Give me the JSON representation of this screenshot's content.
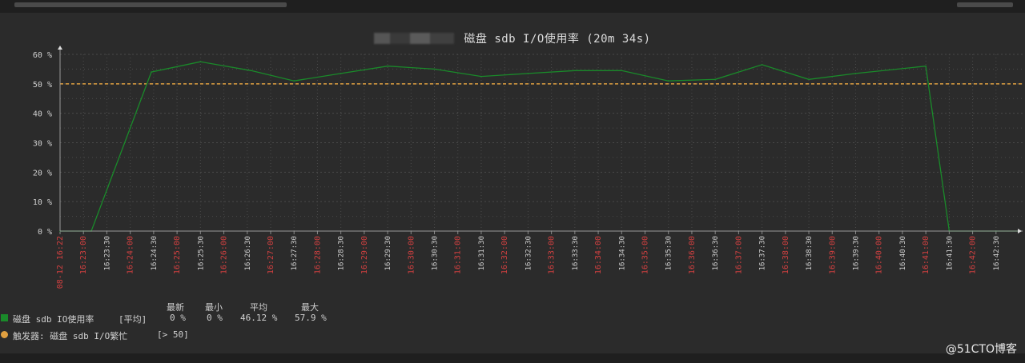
{
  "colors": {
    "background": "#2b2b2b",
    "grid": "#4a4a4a",
    "series": "#1a8a2a",
    "trigger": "#e0a040",
    "tick_red": "#d04040",
    "tick_white": "#d0d0d0"
  },
  "chart_data": {
    "type": "line",
    "title_suffix": "磁盘 sdb I/O使用率 (20m 34s)",
    "ylim": [
      0,
      60
    ],
    "y_ticks": [
      "60 %",
      "50 %",
      "40 %",
      "30 %",
      "20 %",
      "10 %",
      "0 %"
    ],
    "x_ticks": [
      {
        "label": "08-12 16:22",
        "red": true
      },
      {
        "label": "16:23:00",
        "red": true
      },
      {
        "label": "16:23:30",
        "red": false
      },
      {
        "label": "16:24:00",
        "red": true
      },
      {
        "label": "16:24:30",
        "red": false
      },
      {
        "label": "16:25:00",
        "red": true
      },
      {
        "label": "16:25:30",
        "red": false
      },
      {
        "label": "16:26:00",
        "red": true
      },
      {
        "label": "16:26:30",
        "red": false
      },
      {
        "label": "16:27:00",
        "red": true
      },
      {
        "label": "16:27:30",
        "red": false
      },
      {
        "label": "16:28:00",
        "red": true
      },
      {
        "label": "16:28:30",
        "red": false
      },
      {
        "label": "16:29:00",
        "red": true
      },
      {
        "label": "16:29:30",
        "red": false
      },
      {
        "label": "16:30:00",
        "red": true
      },
      {
        "label": "16:30:30",
        "red": false
      },
      {
        "label": "16:31:00",
        "red": true
      },
      {
        "label": "16:31:30",
        "red": false
      },
      {
        "label": "16:32:00",
        "red": true
      },
      {
        "label": "16:32:30",
        "red": false
      },
      {
        "label": "16:33:00",
        "red": true
      },
      {
        "label": "16:33:30",
        "red": false
      },
      {
        "label": "16:34:00",
        "red": true
      },
      {
        "label": "16:34:30",
        "red": false
      },
      {
        "label": "16:35:00",
        "red": true
      },
      {
        "label": "16:35:30",
        "red": false
      },
      {
        "label": "16:36:00",
        "red": true
      },
      {
        "label": "16:36:30",
        "red": false
      },
      {
        "label": "16:37:00",
        "red": true
      },
      {
        "label": "16:37:30",
        "red": false
      },
      {
        "label": "16:38:00",
        "red": true
      },
      {
        "label": "16:38:30",
        "red": false
      },
      {
        "label": "16:39:00",
        "red": true
      },
      {
        "label": "16:39:30",
        "red": false
      },
      {
        "label": "16:40:00",
        "red": true
      },
      {
        "label": "16:40:30",
        "red": false
      },
      {
        "label": "16:41:00",
        "red": true
      },
      {
        "label": "16:41:30",
        "red": false
      },
      {
        "label": "16:42:00",
        "red": true
      },
      {
        "label": "16:42:30",
        "red": false
      }
    ],
    "series": [
      {
        "name": "磁盘 sdb IO使用率",
        "x": [
          "16:22:00",
          "16:22:40",
          "16:23:57",
          "16:25:00",
          "16:26:05",
          "16:27:00",
          "16:28:00",
          "16:29:00",
          "16:30:00",
          "16:31:00",
          "16:32:00",
          "16:33:00",
          "16:34:00",
          "16:35:00",
          "16:36:00",
          "16:37:00",
          "16:38:00",
          "16:39:00",
          "16:40:30",
          "16:41:00",
          "16:42:00",
          "16:42:30"
        ],
        "values": [
          0,
          0,
          54,
          57.5,
          54.5,
          51,
          53.5,
          56,
          55,
          52.5,
          53.5,
          54.5,
          54.5,
          51,
          51.5,
          56.5,
          51.5,
          53.5,
          56,
          0,
          0,
          0
        ]
      }
    ],
    "threshold": 50,
    "legend_placement": "bottom-left",
    "grid": true
  },
  "legend": {
    "headers": [
      "最新",
      "最小",
      "平均",
      "最大"
    ],
    "series_row": {
      "label": "磁盘 sdb IO使用率",
      "func": "[平均]",
      "latest": "0 %",
      "min": "0 %",
      "avg": "46.12 %",
      "max": "57.9 %"
    },
    "trigger_row": {
      "label": "触发器: 磁盘 sdb I/O繁忙",
      "condition": "[> 50]"
    }
  },
  "watermark": "@51CTO博客"
}
